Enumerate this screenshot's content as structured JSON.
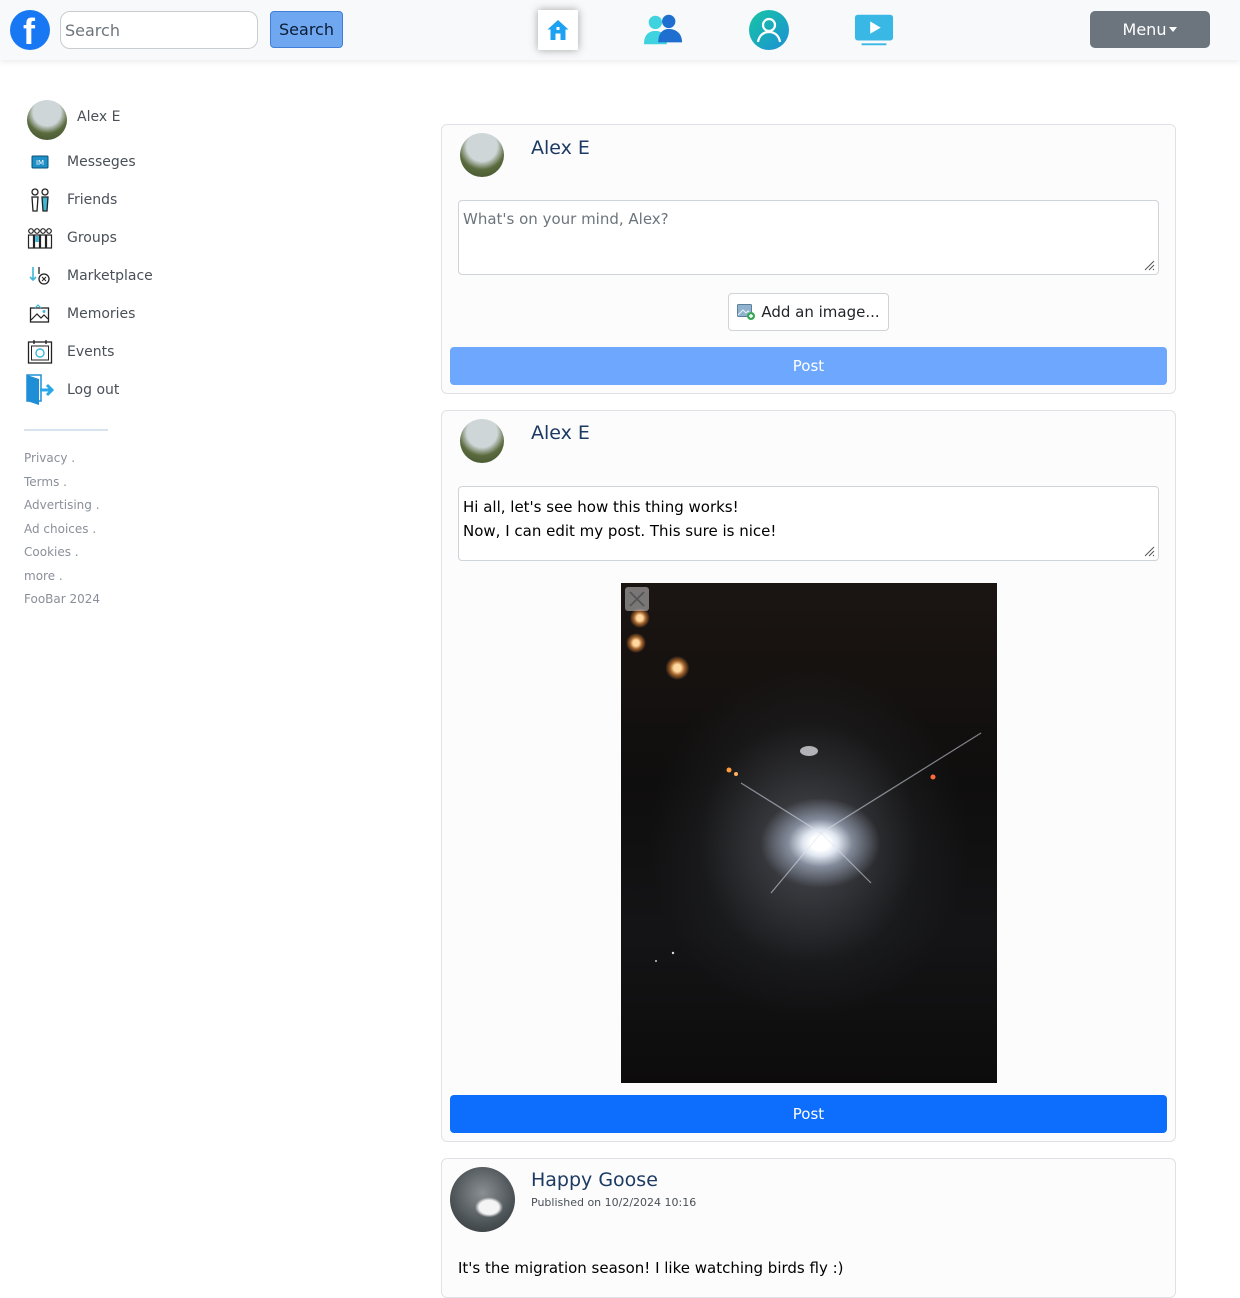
{
  "topbar": {
    "search_placeholder": "Search",
    "search_button": "Search",
    "menu_label": "Menu",
    "nav_icons": [
      "home-icon",
      "friends-icon",
      "profile-icon",
      "watch-icon"
    ]
  },
  "sidebar": {
    "user_name": "Alex E",
    "items": [
      {
        "label": "Messeges",
        "icon": "messages-icon"
      },
      {
        "label": "Friends",
        "icon": "friends-icon"
      },
      {
        "label": "Groups",
        "icon": "groups-icon"
      },
      {
        "label": "Marketplace",
        "icon": "marketplace-icon"
      },
      {
        "label": "Memories",
        "icon": "memories-icon"
      },
      {
        "label": "Events",
        "icon": "events-icon"
      },
      {
        "label": "Log out",
        "icon": "logout-icon"
      }
    ],
    "footer_links": [
      "Privacy .",
      "Terms .",
      "Advertising .",
      "Ad choices .",
      "Cookies .",
      "more ."
    ],
    "copyright": "FooBar 2024"
  },
  "composer": {
    "author": "Alex E",
    "placeholder": "What's on your mind, Alex?",
    "add_image_label": "Add an image...",
    "post_label": "Post"
  },
  "edit_post": {
    "author": "Alex E",
    "text_line1": "Hi all, let's see how this thing works!",
    "text_line2": "Now, I can edit my post. This sure is nice!",
    "post_label": "Post"
  },
  "feed_post": {
    "author": "Happy Goose",
    "published": "Published on 10/2/2024 10:16",
    "text": "It's the migration season! I like watching birds fly :)"
  },
  "colors": {
    "primary": "#0d6efd",
    "primary_disabled": "#6ea8fe",
    "secondary": "#6c757d",
    "brand": "#1877f2",
    "author_name": "#1c3a63"
  }
}
